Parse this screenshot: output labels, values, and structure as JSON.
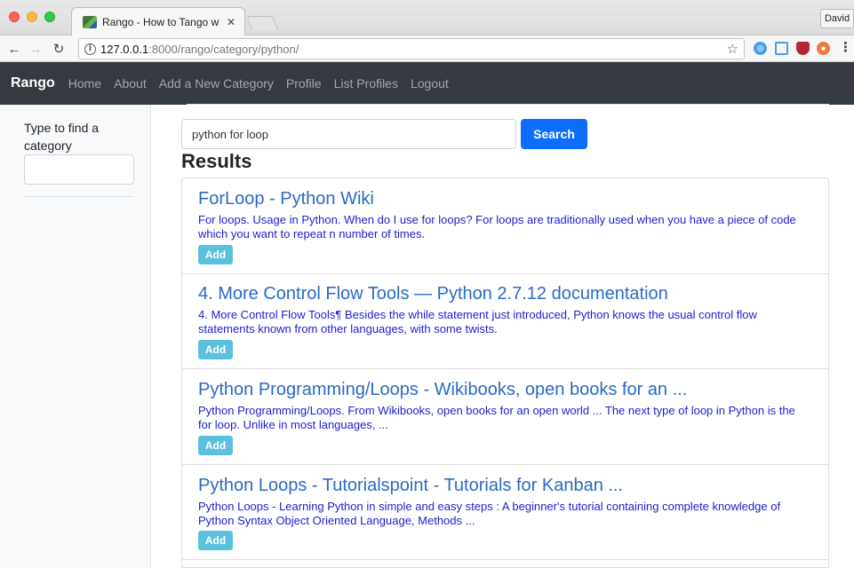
{
  "browser": {
    "tab_title": "Rango - How to Tango with Dj",
    "tab_title_fade": "a",
    "url_host": "127.0.0.1",
    "url_path": ":8000/rango/category/python/",
    "profile_name": "David"
  },
  "navbar": {
    "brand": "Rango",
    "links": [
      "Home",
      "About",
      "Add a New Category",
      "Profile",
      "List Profiles",
      "Logout"
    ]
  },
  "sidebar": {
    "label": "Type to find a category",
    "search_value": ""
  },
  "search": {
    "query": "python for loop",
    "button_label": "Search",
    "results_heading": "Results"
  },
  "results": [
    {
      "title": "ForLoop - Python Wiki",
      "snippet": "For loops. Usage in Python. When do I use for loops? For loops are traditionally used when you have a piece of code which you want to repeat n number of times.",
      "add_label": "Add"
    },
    {
      "title": "4. More Control Flow Tools — Python 2.7.12 documentation",
      "snippet": "4. More Control Flow Tools¶ Besides the while statement just introduced, Python knows the usual control flow statements known from other languages, with some twists.",
      "add_label": "Add"
    },
    {
      "title": "Python Programming/Loops - Wikibooks, open books for an ...",
      "snippet": "Python Programming/Loops. From Wikibooks, open books for an open world ... The next type of loop in Python is the for loop. Unlike in most languages, ...",
      "add_label": "Add"
    },
    {
      "title": "Python Loops - Tutorialspoint - Tutorials for Kanban ...",
      "snippet": "Python Loops - Learning Python in simple and easy steps : A beginner's tutorial containing complete knowledge of Python Syntax Object Oriented Language, Methods ...",
      "add_label": "Add"
    }
  ],
  "colors": {
    "navbar_bg": "#343a40",
    "search_button": "#0d6efd",
    "result_title": "#2a6bc4",
    "result_snippet": "#1b1fcf",
    "add_button": "#5bc0de"
  },
  "icons": [
    "close-icon",
    "back-icon",
    "forward-icon",
    "reload-icon",
    "info-icon",
    "star-icon",
    "menu-icon"
  ]
}
